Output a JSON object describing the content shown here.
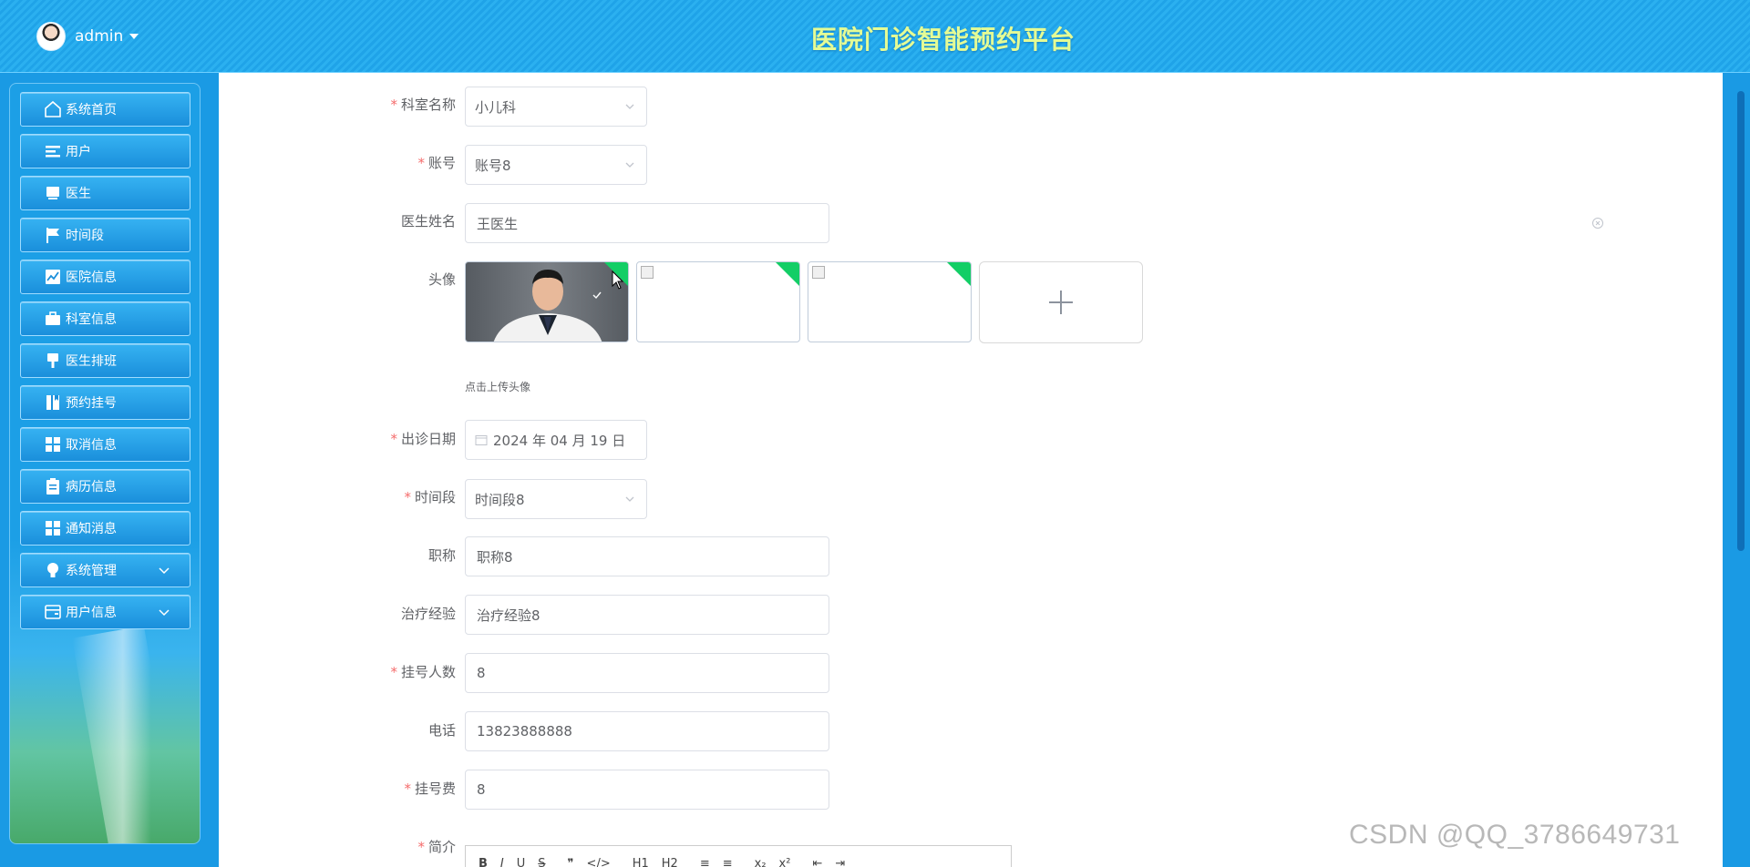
{
  "header": {
    "user_name": "admin",
    "title": "医院门诊智能预约平台"
  },
  "sidebar": {
    "items": [
      {
        "label": "系统首页",
        "icon": "home-icon"
      },
      {
        "label": "用户",
        "icon": "list-icon"
      },
      {
        "label": "医生",
        "icon": "monitor-icon"
      },
      {
        "label": "时间段",
        "icon": "flag-icon"
      },
      {
        "label": "医院信息",
        "icon": "chart-icon"
      },
      {
        "label": "科室信息",
        "icon": "briefcase-icon"
      },
      {
        "label": "医生排班",
        "icon": "brush-icon"
      },
      {
        "label": "预约挂号",
        "icon": "book-icon"
      },
      {
        "label": "取消信息",
        "icon": "grid-icon"
      },
      {
        "label": "病历信息",
        "icon": "clipboard-icon"
      },
      {
        "label": "通知消息",
        "icon": "grid-icon"
      },
      {
        "label": "系统管理",
        "icon": "bulb-icon"
      },
      {
        "label": "用户信息",
        "icon": "wallet-icon"
      }
    ]
  },
  "form": {
    "department": {
      "label": "科室名称",
      "value": "小儿科",
      "required": true
    },
    "account": {
      "label": "账号",
      "value": "账号8",
      "required": true
    },
    "doctor_name": {
      "label": "医生姓名",
      "value": "王医生"
    },
    "avatar": {
      "label": "头像",
      "hint": "点击上传头像"
    },
    "clinic_date": {
      "label": "出诊日期",
      "value": "2024 年 04 月 19 日",
      "required": true
    },
    "time_slot": {
      "label": "时间段",
      "value": "时间段8",
      "required": true
    },
    "title": {
      "label": "职称",
      "value": "职称8"
    },
    "experience": {
      "label": "治疗经验",
      "value": "治疗经验8"
    },
    "registrations": {
      "label": "挂号人数",
      "value": "8",
      "required": true
    },
    "phone": {
      "label": "电话",
      "value": "13823888888"
    },
    "fee": {
      "label": "挂号费",
      "value": "8",
      "required": true
    },
    "intro": {
      "label": "简介",
      "required": true
    }
  },
  "editor_toolbar": [
    "B",
    "I",
    "U",
    "S",
    "❞",
    "</>",
    "H1",
    "H2",
    "≡",
    "≡",
    "x₂",
    "x²",
    "⇤",
    "⇥"
  ],
  "watermark": "CSDN @QQ_3786649731",
  "colors": {
    "header_bg": "#2bb0f0",
    "title": "#e4fb95",
    "required": "#f56c6c",
    "upload_corner": "#13ce66"
  }
}
